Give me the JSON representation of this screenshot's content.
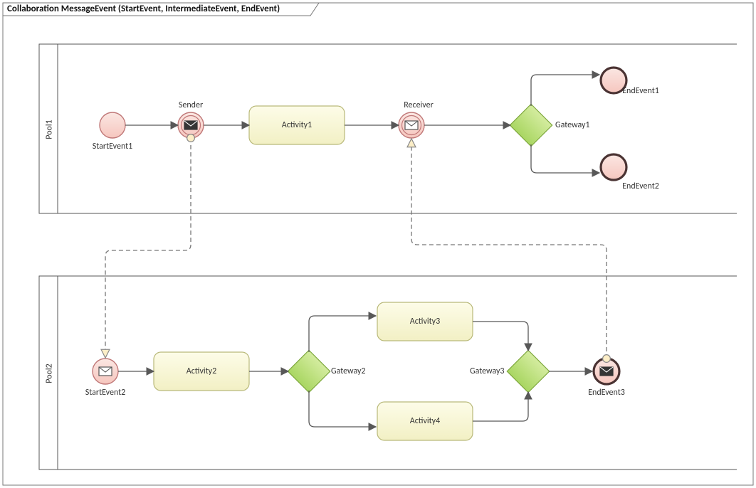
{
  "diagram": {
    "title": "Collaboration MessageEvent (StartEvent, IntermediateEvent, EndEvent)",
    "pools": {
      "p1": "Pool1",
      "p2": "Pool2"
    },
    "nodes": {
      "start1": {
        "label": "StartEvent1"
      },
      "sender": {
        "label": "Sender"
      },
      "act1": {
        "label": "Activity1"
      },
      "receiver": {
        "label": "Receiver"
      },
      "gw1": {
        "label": "Gateway1"
      },
      "end1": {
        "label": "EndEvent1"
      },
      "end2": {
        "label": "EndEvent2"
      },
      "start2": {
        "label": "StartEvent2"
      },
      "act2": {
        "label": "Activity2"
      },
      "gw2": {
        "label": "Gateway2"
      },
      "act3": {
        "label": "Activity3"
      },
      "act4": {
        "label": "Activity4"
      },
      "gw3": {
        "label": "Gateway3"
      },
      "end3": {
        "label": "EndEvent3"
      }
    }
  },
  "chart_data": {
    "type": "bpmn-diagram",
    "title": "Collaboration MessageEvent (StartEvent, IntermediateEvent, EndEvent)",
    "pools": [
      {
        "id": "Pool1",
        "lanes": []
      },
      {
        "id": "Pool2",
        "lanes": []
      }
    ],
    "nodes": [
      {
        "id": "StartEvent1",
        "pool": "Pool1",
        "type": "startEvent"
      },
      {
        "id": "Sender",
        "pool": "Pool1",
        "type": "intermediateThrowEvent-message"
      },
      {
        "id": "Activity1",
        "pool": "Pool1",
        "type": "task"
      },
      {
        "id": "Receiver",
        "pool": "Pool1",
        "type": "intermediateCatchEvent-message"
      },
      {
        "id": "Gateway1",
        "pool": "Pool1",
        "type": "exclusiveGateway"
      },
      {
        "id": "EndEvent1",
        "pool": "Pool1",
        "type": "endEvent"
      },
      {
        "id": "EndEvent2",
        "pool": "Pool1",
        "type": "endEvent"
      },
      {
        "id": "StartEvent2",
        "pool": "Pool2",
        "type": "startEvent-message"
      },
      {
        "id": "Activity2",
        "pool": "Pool2",
        "type": "task"
      },
      {
        "id": "Gateway2",
        "pool": "Pool2",
        "type": "exclusiveGateway"
      },
      {
        "id": "Activity3",
        "pool": "Pool2",
        "type": "task"
      },
      {
        "id": "Activity4",
        "pool": "Pool2",
        "type": "task"
      },
      {
        "id": "Gateway3",
        "pool": "Pool2",
        "type": "exclusiveGateway"
      },
      {
        "id": "EndEvent3",
        "pool": "Pool2",
        "type": "endEvent-message"
      }
    ],
    "sequenceFlows": [
      {
        "from": "StartEvent1",
        "to": "Sender"
      },
      {
        "from": "Sender",
        "to": "Activity1"
      },
      {
        "from": "Activity1",
        "to": "Receiver"
      },
      {
        "from": "Receiver",
        "to": "Gateway1"
      },
      {
        "from": "Gateway1",
        "to": "EndEvent1"
      },
      {
        "from": "Gateway1",
        "to": "EndEvent2"
      },
      {
        "from": "StartEvent2",
        "to": "Activity2"
      },
      {
        "from": "Activity2",
        "to": "Gateway2"
      },
      {
        "from": "Gateway2",
        "to": "Activity3"
      },
      {
        "from": "Gateway2",
        "to": "Activity4"
      },
      {
        "from": "Activity3",
        "to": "Gateway3"
      },
      {
        "from": "Activity4",
        "to": "Gateway3"
      },
      {
        "from": "Gateway3",
        "to": "EndEvent3"
      }
    ],
    "messageFlows": [
      {
        "from": "Sender",
        "to": "StartEvent2"
      },
      {
        "from": "EndEvent3",
        "to": "Receiver"
      }
    ]
  }
}
